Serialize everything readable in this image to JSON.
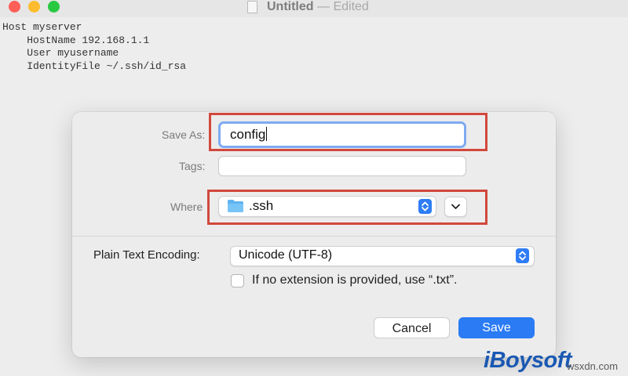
{
  "window": {
    "title": "Untitled",
    "title_separator": "—",
    "title_status": "Edited"
  },
  "editor": {
    "lines": [
      "Host myserver",
      "    HostName 192.168.1.1",
      "    User myusername",
      "    IdentityFile ~/.ssh/id_rsa"
    ]
  },
  "save_dialog": {
    "save_as_label": "Save As:",
    "save_as_value": "config",
    "tags_label": "Tags:",
    "tags_value": "",
    "where_label": "Where",
    "where_value": ".ssh",
    "encoding_label": "Plain Text Encoding:",
    "encoding_value": "Unicode (UTF-8)",
    "extension_checkbox_label": "If no extension is provided, use “.txt”.",
    "extension_checkbox_checked": false,
    "cancel_label": "Cancel",
    "save_label": "Save"
  },
  "icons": {
    "folder": "folder-icon",
    "stepper": "up-down-chevron-icon",
    "expand": "chevron-down-icon",
    "document": "document-icon"
  },
  "colors": {
    "accent": "#2a7bf4",
    "highlight_box": "#d2483c",
    "close": "#ff5f57",
    "minimize": "#febc2e",
    "maximize": "#28c840"
  },
  "watermark": {
    "brand": "iBoysoft",
    "site": "wsxdn.com"
  }
}
